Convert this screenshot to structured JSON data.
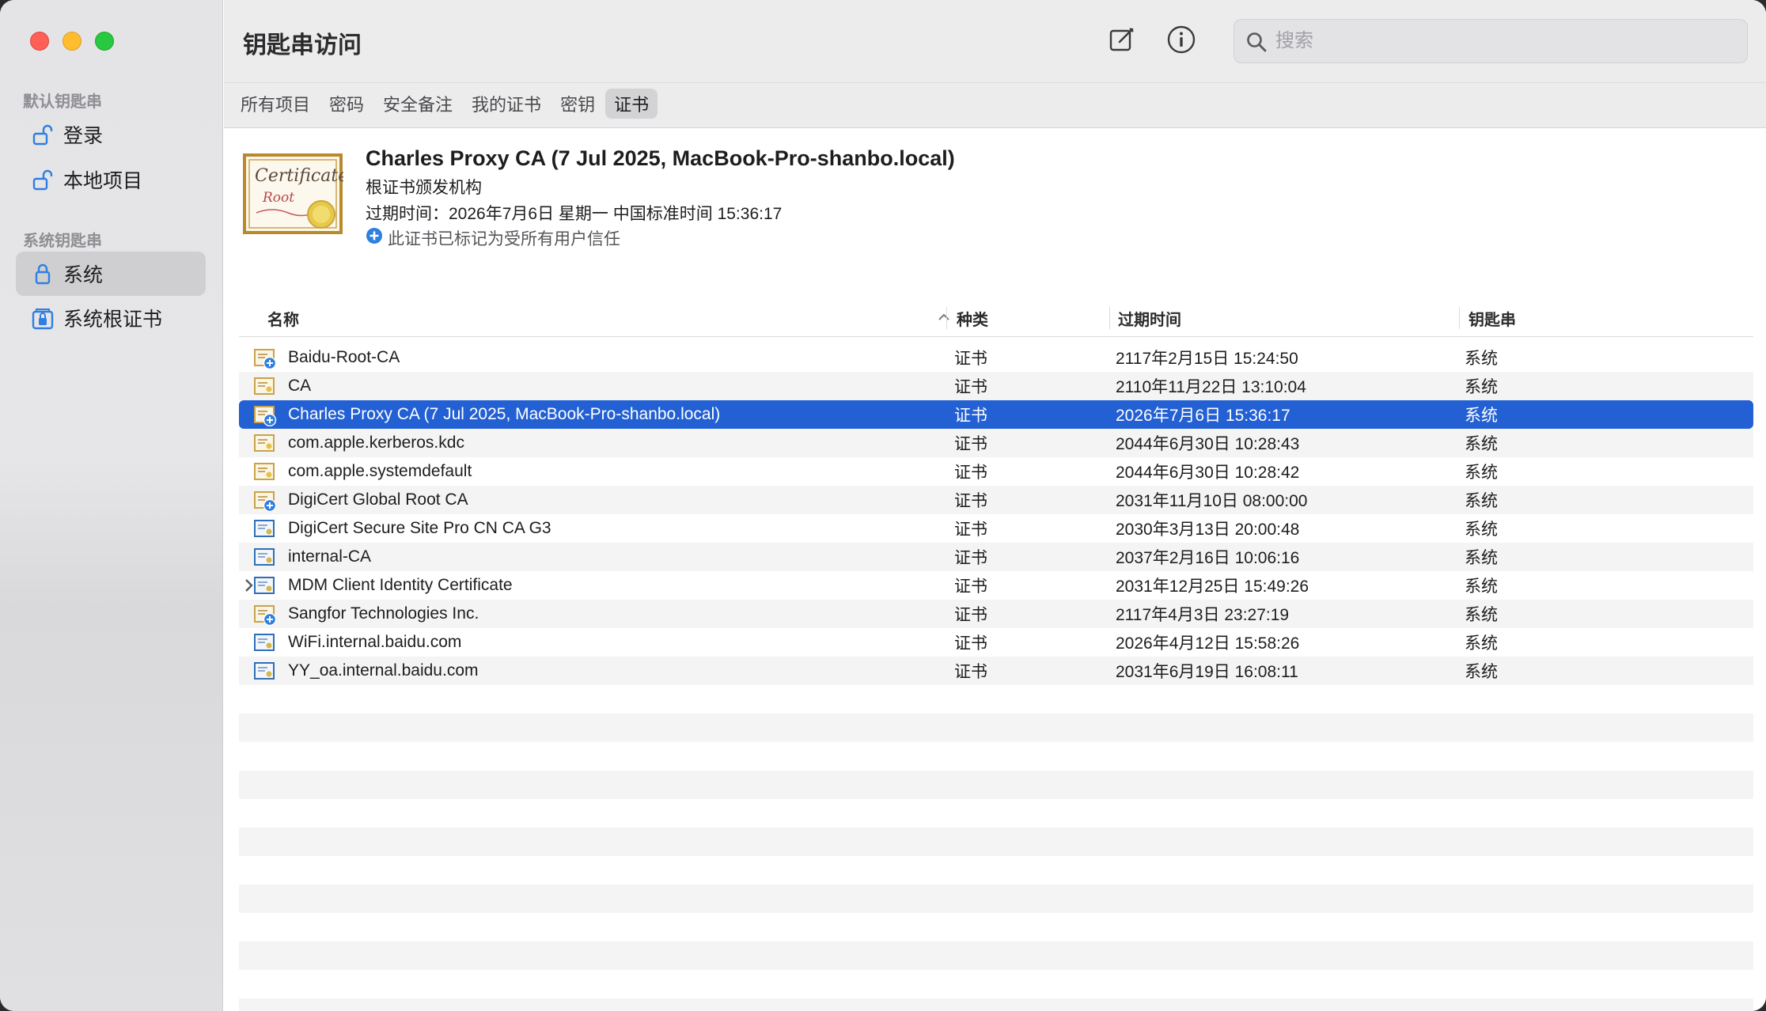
{
  "window": {
    "title": "钥匙串访问"
  },
  "sidebar": {
    "section_default": "默认钥匙串",
    "section_system": "系统钥匙串",
    "items": [
      {
        "label": "登录",
        "icon": "unlocked-padlock-icon"
      },
      {
        "label": "本地项目",
        "icon": "unlocked-padlock-icon"
      },
      {
        "label": "系统",
        "icon": "locked-padlock-icon",
        "selected": true
      },
      {
        "label": "系统根证书",
        "icon": "locked-cabinet-icon"
      }
    ]
  },
  "toolbar": {
    "compose_icon": "compose-icon",
    "info_icon": "info-icon",
    "search_placeholder": "搜索"
  },
  "tabs": [
    {
      "label": "所有项目"
    },
    {
      "label": "密码"
    },
    {
      "label": "安全备注"
    },
    {
      "label": "我的证书"
    },
    {
      "label": "密钥"
    },
    {
      "label": "证书",
      "active": true
    }
  ],
  "detail": {
    "name": "Charles Proxy CA (7 Jul 2025, MacBook-Pro-shanbo.local)",
    "kind": "根证书颁发机构",
    "expiry": "过期时间：2026年7月6日 星期一 中国标准时间 15:36:17",
    "trust": "此证书已标记为受所有用户信任",
    "thumb_text_1": "Certificate",
    "thumb_text_2": "Root"
  },
  "table": {
    "columns": {
      "name": "名称",
      "kind": "种类",
      "expires": "过期时间",
      "keychain": "钥匙串"
    },
    "rows": [
      {
        "name": "Baidu-Root-CA",
        "kind": "证书",
        "expires": "2117年2月15日 15:24:50",
        "keychain": "系统",
        "icon": "root-cert-icon"
      },
      {
        "name": "CA",
        "kind": "证书",
        "expires": "2110年11月22日 13:10:04",
        "keychain": "系统",
        "icon": "cert-icon"
      },
      {
        "name": "Charles Proxy CA (7 Jul 2025, MacBook-Pro-shanbo.local)",
        "kind": "证书",
        "expires": "2026年7月6日 15:36:17",
        "keychain": "系统",
        "icon": "root-cert-icon",
        "selected": true
      },
      {
        "name": "com.apple.kerberos.kdc",
        "kind": "证书",
        "expires": "2044年6月30日 10:28:43",
        "keychain": "系统",
        "icon": "cert-icon"
      },
      {
        "name": "com.apple.systemdefault",
        "kind": "证书",
        "expires": "2044年6月30日 10:28:42",
        "keychain": "系统",
        "icon": "cert-icon"
      },
      {
        "name": "DigiCert Global Root CA",
        "kind": "证书",
        "expires": "2031年11月10日 08:00:00",
        "keychain": "系统",
        "icon": "root-cert-icon"
      },
      {
        "name": "DigiCert Secure Site Pro CN CA G3",
        "kind": "证书",
        "expires": "2030年3月13日 20:00:48",
        "keychain": "系统",
        "icon": "intermediate-cert-icon"
      },
      {
        "name": "internal-CA",
        "kind": "证书",
        "expires": "2037年2月16日 10:06:16",
        "keychain": "系统",
        "icon": "intermediate-cert-icon"
      },
      {
        "name": "MDM Client Identity Certificate",
        "kind": "证书",
        "expires": "2031年12月25日 15:49:26",
        "keychain": "系统",
        "icon": "intermediate-cert-icon",
        "expandable": true
      },
      {
        "name": "Sangfor Technologies Inc.",
        "kind": "证书",
        "expires": "2117年4月3日 23:27:19",
        "keychain": "系统",
        "icon": "root-cert-icon"
      },
      {
        "name": "WiFi.internal.baidu.com",
        "kind": "证书",
        "expires": "2026年4月12日 15:58:26",
        "keychain": "系统",
        "icon": "intermediate-cert-icon"
      },
      {
        "name": "YY_oa.internal.baidu.com",
        "kind": "证书",
        "expires": "2031年6月19日 16:08:11",
        "keychain": "系统",
        "icon": "intermediate-cert-icon"
      }
    ]
  },
  "colors": {
    "selection": "#2260d3",
    "trust_blue": "#2f7fe0",
    "cert_gold": "#c9a24a"
  }
}
